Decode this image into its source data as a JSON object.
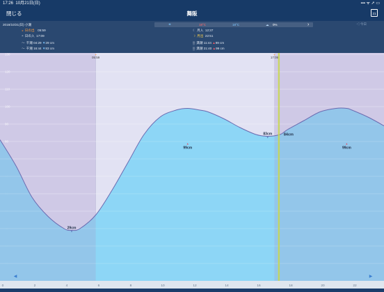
{
  "status_bar": {
    "time": "17:26",
    "date": "10月21日(日)",
    "icons": "▪▪▪ ᯤ ➚ ▭"
  },
  "nav": {
    "close_label": "閉じる",
    "title": "舞阪",
    "calendar_label": "21"
  },
  "info": {
    "date_tide": "2018/10/21(日) 小潮",
    "weather": {
      "low_temp": "18°C",
      "high_temp": "18°C",
      "rain": "0%",
      "forward_arrow": "›"
    },
    "prev_label": "◁ 今日",
    "sunrise": {
      "label": "日の出",
      "time": "05:59"
    },
    "sunset": {
      "label": "日の入",
      "time": "17:09"
    },
    "moonset": {
      "label": "月入",
      "time": "12:37"
    },
    "moonrise": {
      "label": "月出",
      "time": "22:51"
    },
    "low_tides": [
      {
        "label": "干潮",
        "time": "04:29",
        "height": "29 cm"
      },
      {
        "label": "干潮",
        "time": "16:44",
        "height": "83 cm"
      }
    ],
    "high_tides": [
      {
        "label": "満潮",
        "time": "11:44",
        "height": "99 cm"
      },
      {
        "label": "満潮",
        "time": "21:40",
        "height": "99 cm"
      }
    ]
  },
  "chart_data": {
    "type": "area",
    "xlabel": "",
    "ylabel": "",
    "xlim": [
      0,
      24
    ],
    "ylim": [
      0,
      130
    ],
    "x_ticks": [
      0,
      2,
      4,
      6,
      8,
      10,
      12,
      14,
      16,
      18,
      20,
      22
    ],
    "y_ticks": [
      10,
      20,
      30,
      40,
      50,
      60,
      70,
      80,
      90,
      100,
      110,
      120,
      130
    ],
    "series": [
      {
        "x": [
          0,
          1,
          2,
          3,
          4,
          4.48,
          5,
          6,
          7,
          8,
          9,
          10,
          11,
          11.73,
          12.5,
          13,
          14,
          15,
          16,
          16.73,
          17.5,
          18,
          19,
          20,
          21,
          21.67,
          22,
          23,
          24
        ],
        "values": [
          81,
          66,
          48,
          37,
          30,
          29,
          30,
          38,
          52,
          68,
          84,
          94,
          98,
          99,
          98,
          97,
          93,
          88,
          84,
          83,
          84,
          87,
          92,
          97,
          99,
          99,
          98,
          94,
          89
        ]
      }
    ],
    "day_start": 5.983,
    "day_end": 17.15,
    "day_start_label": "05:59",
    "day_end_label": "17:09",
    "current_time": 17.43,
    "current_label": "84cm",
    "annotations": [
      {
        "x": 4.48,
        "y": 29,
        "kind": "low",
        "label": "29cm"
      },
      {
        "x": 11.73,
        "y": 99,
        "kind": "high",
        "label": "99cm"
      },
      {
        "x": 16.73,
        "y": 83,
        "kind": "low",
        "label": "83cm"
      },
      {
        "x": 21.67,
        "y": 99,
        "kind": "high",
        "label": "99cm"
      }
    ],
    "colors": {
      "night_bg": "#cfc9e6",
      "day_bg": "#e2e2f3",
      "fill": "#8dd6f6",
      "fill_night": "#8fc6ea",
      "curve": "#6a6ab0",
      "now_line": "#c9d84a"
    },
    "nav_prev": "◀",
    "nav_next": "▶"
  }
}
